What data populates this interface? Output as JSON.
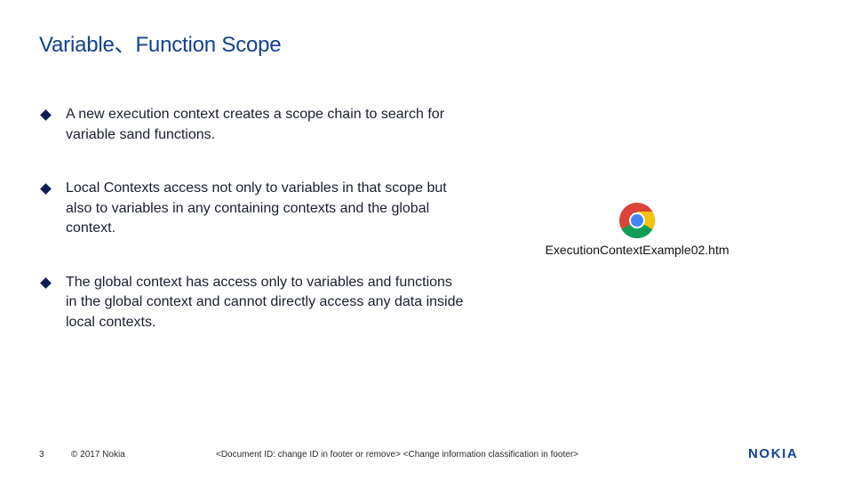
{
  "slide": {
    "title": "Variable、Function Scope",
    "bullets": [
      "A new execution context  creates a scope chain to search for variable sand functions.",
      "Local Contexts access not only to variables in that scope but also to variables in any containing contexts and the global context.",
      "The global context has access only to variables and functions in the global context and cannot directly access any data inside local contexts."
    ]
  },
  "attachment": {
    "icon": "chrome-icon",
    "file_name": "ExecutionContextExample02.htm"
  },
  "footer": {
    "page_number": "3",
    "copyright": "© 2017 Nokia",
    "document_info": "<Document ID: change ID in footer or remove> <Change information classification in footer>"
  },
  "brand": {
    "logo_text": "NOKIA",
    "color": "#124191"
  }
}
